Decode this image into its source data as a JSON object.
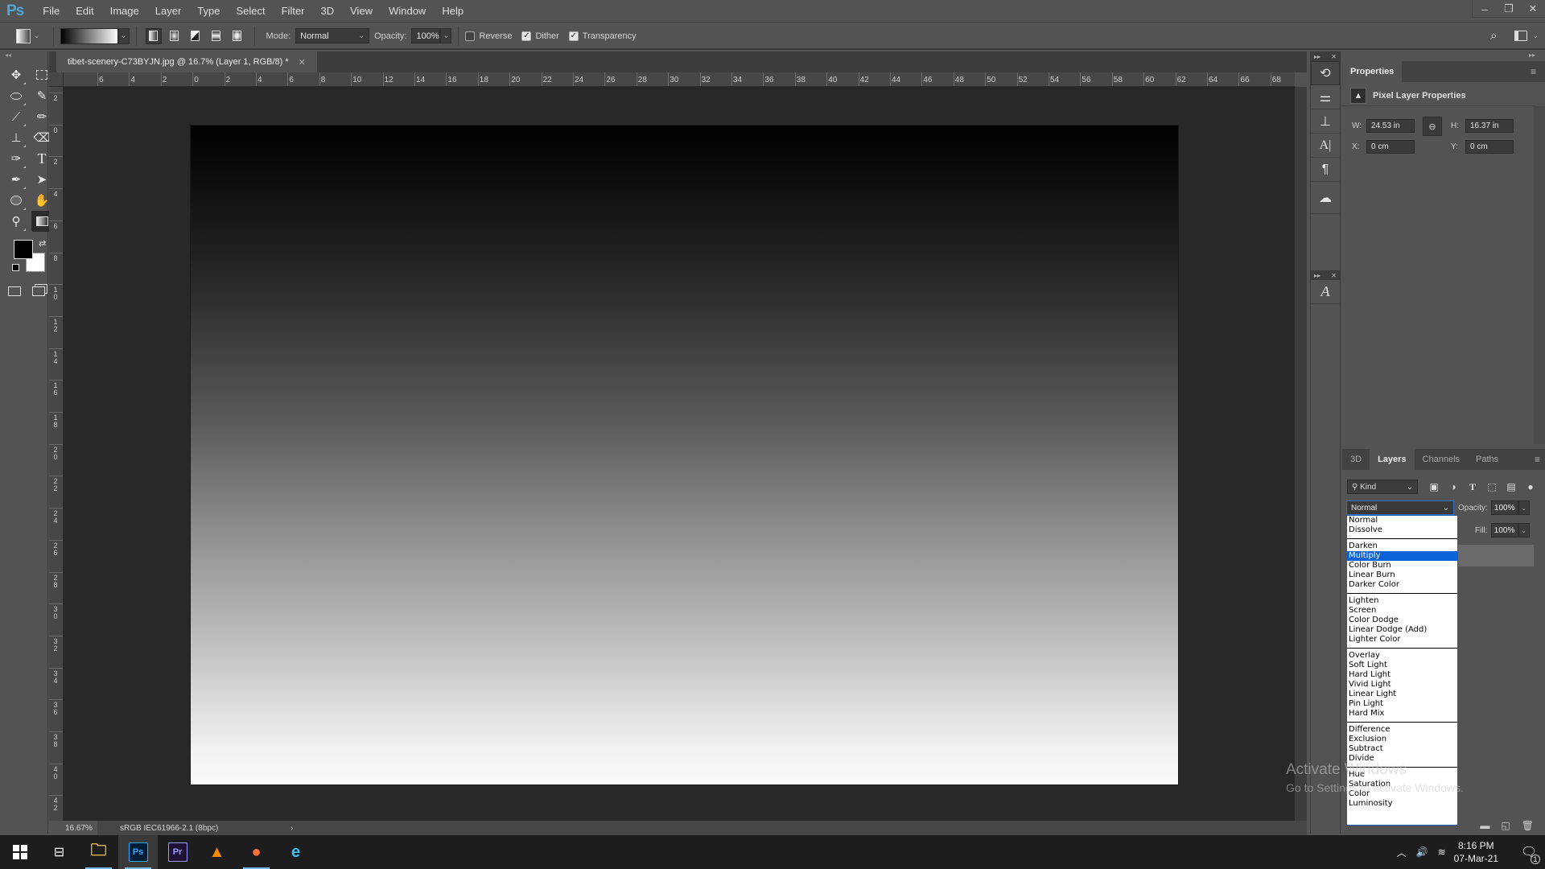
{
  "app": {
    "logo": "Ps",
    "menu": [
      "File",
      "Edit",
      "Image",
      "Layer",
      "Type",
      "Select",
      "Filter",
      "3D",
      "View",
      "Window",
      "Help"
    ],
    "window_controls": {
      "minimize": "–",
      "restore": "❐",
      "close": "✕"
    }
  },
  "options_bar": {
    "mode_label": "Mode:",
    "mode_value": "Normal",
    "opacity_label": "Opacity:",
    "opacity_value": "100%",
    "reverse_label": "Reverse",
    "reverse_checked": false,
    "dither_label": "Dither",
    "dither_checked": true,
    "transparency_label": "Transparency",
    "transparency_checked": true,
    "gradient_types": [
      "linear",
      "radial",
      "angle",
      "reflected",
      "diamond"
    ]
  },
  "tools": [
    {
      "name": "move-tool",
      "glyph": "✥"
    },
    {
      "name": "marquee-tool",
      "glyph": "⬚"
    },
    {
      "name": "lasso-tool",
      "glyph": "ↄ"
    },
    {
      "name": "quick-selection-tool",
      "glyph": "✎"
    },
    {
      "name": "eyedropper-tool",
      "glyph": "⚲"
    },
    {
      "name": "brush-tool",
      "glyph": "🖌"
    },
    {
      "name": "clone-stamp-tool",
      "glyph": "⊥"
    },
    {
      "name": "eraser-tool",
      "glyph": "⌫"
    },
    {
      "name": "history-brush-tool",
      "glyph": "✑"
    },
    {
      "name": "type-tool",
      "glyph": "T"
    },
    {
      "name": "pen-tool",
      "glyph": "✒"
    },
    {
      "name": "path-selection-tool",
      "glyph": "➤"
    },
    {
      "name": "ellipse-tool",
      "glyph": "⬭"
    },
    {
      "name": "hand-tool",
      "glyph": "✋"
    },
    {
      "name": "zoom-tool",
      "glyph": "⚲"
    },
    {
      "name": "gradient-tool",
      "glyph": "▣"
    }
  ],
  "document": {
    "tab_title": "tibet-scenery-C73BYJN.jpg @ 16.7% (Layer 1, RGB/8) *",
    "zoom": "16.67%",
    "color_profile": "sRGB IEC61966-2.1 (8bpc)",
    "ruler_top_labels": [
      "6",
      "4",
      "2",
      "0",
      "2",
      "4",
      "6",
      "8",
      "10",
      "12",
      "14",
      "16",
      "18",
      "20",
      "22",
      "24",
      "26",
      "28",
      "30",
      "32",
      "34",
      "36",
      "38",
      "40",
      "42",
      "44",
      "46",
      "48",
      "50",
      "52",
      "54",
      "56",
      "58",
      "60",
      "62",
      "64",
      "66",
      "68"
    ],
    "ruler_left_labels": [
      "2",
      "0",
      "2",
      "4",
      "6",
      "8",
      "10",
      "12",
      "14",
      "16",
      "18",
      "20",
      "22",
      "24",
      "26",
      "28",
      "30",
      "32",
      "34",
      "36",
      "38",
      "40",
      "42"
    ]
  },
  "properties": {
    "tab": "Properties",
    "subtitle": "Pixel Layer Properties",
    "w_label": "W:",
    "w_value": "24.53 in",
    "h_label": "H:",
    "h_value": "16.37 in",
    "x_label": "X:",
    "x_value": "0 cm",
    "y_label": "Y:",
    "y_value": "0 cm"
  },
  "layers": {
    "tabs": [
      "3D",
      "Layers",
      "Channels",
      "Paths"
    ],
    "active_tab": "Layers",
    "filter_kind": "Kind",
    "blend_mode": "Normal",
    "opacity_label": "Opacity:",
    "opacity_value": "100%",
    "fill_label": "Fill:",
    "fill_value": "100%"
  },
  "blend_dropdown": {
    "groups": [
      [
        "Normal",
        "Dissolve"
      ],
      [
        "Darken",
        "Multiply",
        "Color Burn",
        "Linear Burn",
        "Darker Color"
      ],
      [
        "Lighten",
        "Screen",
        "Color Dodge",
        "Linear Dodge (Add)",
        "Lighter Color"
      ],
      [
        "Overlay",
        "Soft Light",
        "Hard Light",
        "Vivid Light",
        "Linear Light",
        "Pin Light",
        "Hard Mix"
      ],
      [
        "Difference",
        "Exclusion",
        "Subtract",
        "Divide"
      ],
      [
        "Hue",
        "Saturation",
        "Color",
        "Luminosity"
      ]
    ],
    "highlighted": "Multiply"
  },
  "watermark": {
    "line1": "Activate Windows",
    "line2": "Go to Settings to activate Windows."
  },
  "taskbar": {
    "apps": [
      {
        "name": "file-explorer",
        "label": "🗀",
        "color": "#f2c14e"
      },
      {
        "name": "photoshop",
        "label": "Ps",
        "color": "#31a8ff"
      },
      {
        "name": "premiere-pro",
        "label": "Pr",
        "color": "#9999ff"
      },
      {
        "name": "vlc",
        "label": "▲",
        "color": "#f48b00"
      },
      {
        "name": "firefox",
        "label": "●",
        "color": "#ff7139"
      },
      {
        "name": "edge",
        "label": "e",
        "color": "#35c1f1"
      }
    ],
    "time": "8:16 PM",
    "date": "07-Mar-21",
    "notification_count": "1"
  }
}
